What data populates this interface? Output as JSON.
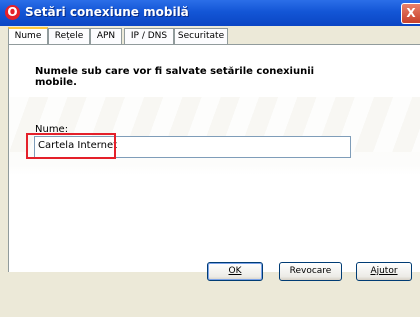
{
  "window": {
    "title": "Setări conexiune mobilă",
    "logo_glyph": "O",
    "close_glyph": "X",
    "brand_color": "#e4202a"
  },
  "tabs": [
    {
      "label": "Nume",
      "active": true
    },
    {
      "label": "Rețele",
      "active": false
    },
    {
      "label": "APN",
      "active": false
    },
    {
      "label": "IP / DNS",
      "active": false
    },
    {
      "label": "Securitate",
      "active": false
    }
  ],
  "main": {
    "heading": "Numele sub care vor fi salvate setările conexiunii mobile.",
    "name_label": "Nume:",
    "name_value": "Cartela Internet"
  },
  "buttons": {
    "ok_label": "OK",
    "cancel_label": "Revocare",
    "help_label": "Ajutor"
  }
}
